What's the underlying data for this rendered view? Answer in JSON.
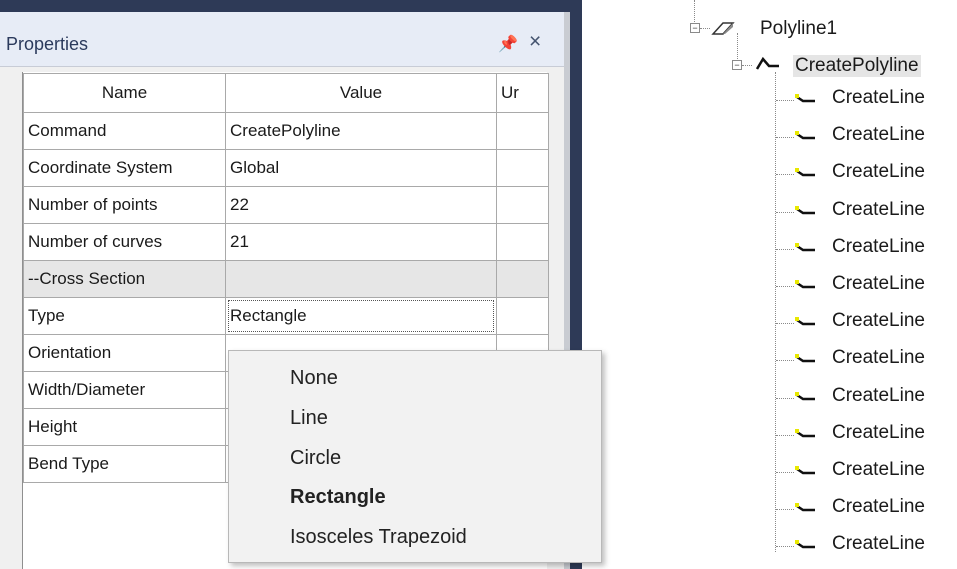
{
  "properties_panel": {
    "title": "Properties",
    "pin_glyph": "¤",
    "close_glyph": "×",
    "columns": [
      "Name",
      "Value",
      "Ur"
    ],
    "rows": [
      {
        "name": "Command",
        "value": "CreatePolyline"
      },
      {
        "name": "Coordinate System",
        "value": "Global"
      },
      {
        "name": "Number of points",
        "value": "22"
      },
      {
        "name": "Number of curves",
        "value": "21"
      },
      {
        "name": "--Cross Section",
        "value": "",
        "section": true
      },
      {
        "name": "Type",
        "value": "Rectangle"
      },
      {
        "name": "Orientation",
        "value": ""
      },
      {
        "name": "Width/Diameter",
        "value": ""
      },
      {
        "name": "Height",
        "value": ""
      },
      {
        "name": "Bend Type",
        "value": ""
      }
    ]
  },
  "type_dropdown": {
    "options": [
      "None",
      "Line",
      "Circle",
      "Rectangle",
      "Isosceles Trapezoid"
    ],
    "selected": "Rectangle"
  },
  "tree": {
    "root": {
      "label": "Polyline1",
      "icon": "polyline-object-icon"
    },
    "child": {
      "label": "CreatePolyline",
      "icon": "create-polyline-icon"
    },
    "segments": [
      "CreateLine",
      "CreateLine",
      "CreateLine",
      "CreateLine",
      "CreateLine",
      "CreateLine",
      "CreateLine",
      "CreateLine",
      "CreateLine",
      "CreateLine",
      "CreateLine",
      "CreateLine",
      "CreateLine"
    ],
    "segment_icon": "create-line-icon"
  },
  "colors": {
    "frame": "#2e3a57",
    "panel_title_bg": "#e7ecf6",
    "selection": "#e5e5e5"
  }
}
